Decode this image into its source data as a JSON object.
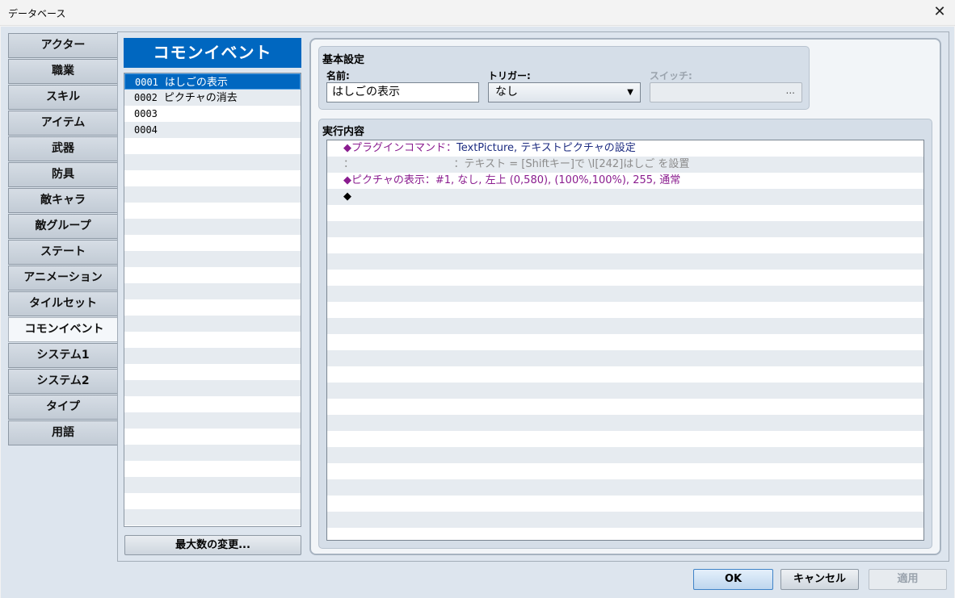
{
  "window": {
    "title": "データベース",
    "close_icon": "close-icon"
  },
  "tabs": [
    {
      "label": "アクター",
      "active": false
    },
    {
      "label": "職業",
      "active": false
    },
    {
      "label": "スキル",
      "active": false
    },
    {
      "label": "アイテム",
      "active": false
    },
    {
      "label": "武器",
      "active": false
    },
    {
      "label": "防具",
      "active": false
    },
    {
      "label": "敵キャラ",
      "active": false
    },
    {
      "label": "敵グループ",
      "active": false
    },
    {
      "label": "ステート",
      "active": false
    },
    {
      "label": "アニメーション",
      "active": false
    },
    {
      "label": "タイルセット",
      "active": false
    },
    {
      "label": "コモンイベント",
      "active": true
    },
    {
      "label": "システム1",
      "active": false
    },
    {
      "label": "システム2",
      "active": false
    },
    {
      "label": "タイプ",
      "active": false
    },
    {
      "label": "用語",
      "active": false
    }
  ],
  "list": {
    "header": "コモンイベント",
    "items": [
      {
        "id": "0001",
        "name": "はしごの表示",
        "selected": true
      },
      {
        "id": "0002",
        "name": "ピクチャの消去",
        "selected": false
      },
      {
        "id": "0003",
        "name": "",
        "selected": false
      },
      {
        "id": "0004",
        "name": "",
        "selected": false
      }
    ],
    "max_button": "最大数の変更..."
  },
  "basic": {
    "title": "基本設定",
    "name_label": "名前:",
    "name_value": "はしごの表示",
    "trigger_label": "トリガー:",
    "trigger_value": "なし",
    "switch_label": "スイッチ:",
    "switch_button": "..."
  },
  "exec": {
    "title": "実行内容",
    "rows": [
      {
        "kind": "plugin",
        "prefix": "◆プラグインコマンド：",
        "cmd": "TextPicture, テキストピクチャの設定"
      },
      {
        "kind": "cont",
        "prefix": "：",
        "cmd": "：テキスト = [Shiftキー]で \\I[242]はしご を設置"
      },
      {
        "kind": "pic",
        "prefix": "◆ピクチャの表示：",
        "cmd": "#1, なし, 左上 (0,580), (100%,100%), 255, 通常"
      },
      {
        "kind": "empty",
        "prefix": "◆",
        "cmd": ""
      }
    ]
  },
  "buttons": {
    "ok": "OK",
    "cancel": "キャンセル",
    "apply": "適用"
  }
}
